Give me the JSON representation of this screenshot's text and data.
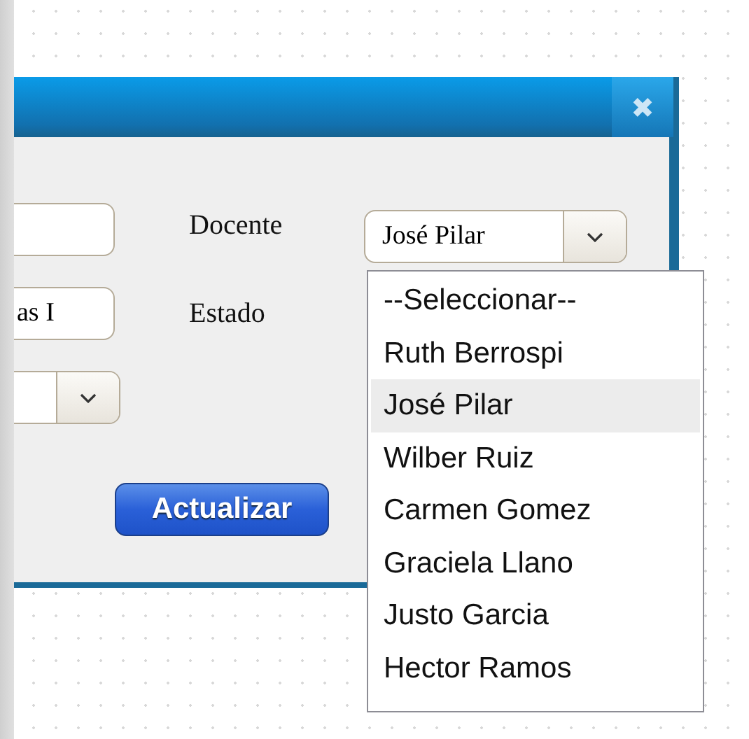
{
  "dialog": {
    "close_label": "✖"
  },
  "left_fields": [
    {
      "kind": "text"
    },
    {
      "kind": "text",
      "value": "as I"
    },
    {
      "kind": "select"
    }
  ],
  "docente": {
    "label": "Docente",
    "value": "José Pilar",
    "expanded": true,
    "options": [
      {
        "label": "--Seleccionar--",
        "selected": false
      },
      {
        "label": "Ruth Berrospi",
        "selected": false
      },
      {
        "label": "José Pilar",
        "selected": true
      },
      {
        "label": "Wilber Ruiz",
        "selected": false
      },
      {
        "label": "Carmen Gomez",
        "selected": false
      },
      {
        "label": "Graciela Llano",
        "selected": false
      },
      {
        "label": "Justo Garcia",
        "selected": false
      },
      {
        "label": "Hector Ramos",
        "selected": false
      }
    ]
  },
  "estado": {
    "label": "Estado"
  },
  "button": "Actualizar"
}
